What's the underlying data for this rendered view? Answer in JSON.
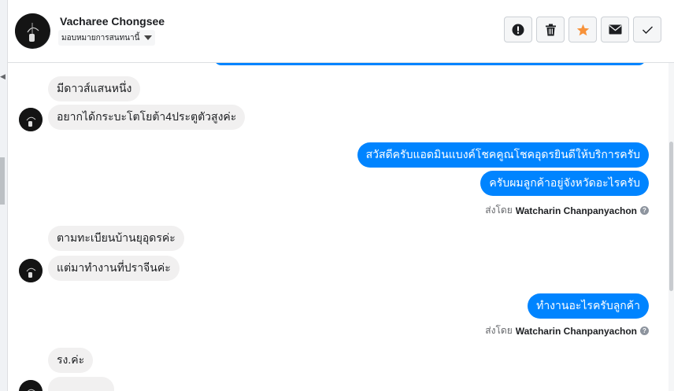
{
  "contact": {
    "name": "Vacharee Chongsee",
    "assign_label": "มอบหมายการสนทนานี้"
  },
  "actions": [
    {
      "name": "spam-button",
      "icon": "exclamation-icon"
    },
    {
      "name": "delete-button",
      "icon": "trash-icon"
    },
    {
      "name": "star-button",
      "icon": "star-icon",
      "color": "#f7923a"
    },
    {
      "name": "mark-unread-button",
      "icon": "envelope-icon"
    },
    {
      "name": "done-button",
      "icon": "check-icon"
    }
  ],
  "messages": {
    "m1": "มีดาวส์แสนหนึ่ง",
    "m2": "อยากได้กระบะโตโยต้า4ประตูตัวสูงค่ะ",
    "m3": "สวัสดีครับแอดมินแบงค์โชคคูณโชคอุดรยินดีให้บริการครับ",
    "m4": "ครับผมลูกค้าอยู่จังหวัดอะไรครับ",
    "m5": "ตามทะเบียนบ้านยุอุดรค่ะ",
    "m6": "แต่มาทำงานที่ปราจีนค่ะ",
    "m7": "ทำงานอะไรครับลูกค้า",
    "m8": "รง.ค่ะ"
  },
  "sent_by": {
    "prefix": "ส่งโดย",
    "agent": "Watcharin Chanpanyachon"
  },
  "colors": {
    "outgoing": "#0084ff",
    "incoming": "#f1f0f0"
  }
}
